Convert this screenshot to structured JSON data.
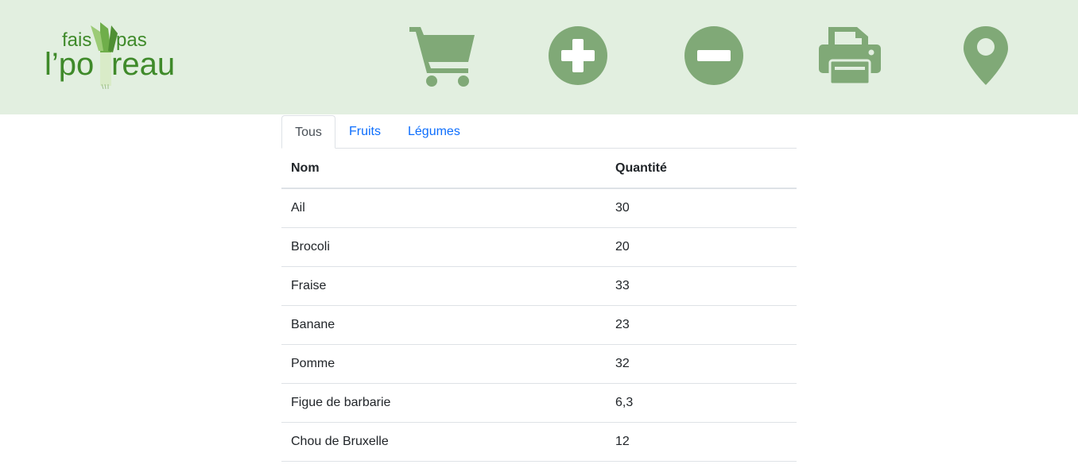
{
  "header": {
    "logo": {
      "line1_a": "fais",
      "line1_b": "pas",
      "line2_a": "l’po",
      "line2_b": "reau"
    },
    "icons": [
      {
        "name": "cart-icon"
      },
      {
        "name": "add-circle-icon"
      },
      {
        "name": "remove-circle-icon"
      },
      {
        "name": "print-icon"
      },
      {
        "name": "map-marker-icon"
      }
    ],
    "icon_color": "#80a977",
    "background_color": "#e2efe0"
  },
  "tabs": [
    {
      "label": "Tous",
      "active": true
    },
    {
      "label": "Fruits",
      "active": false
    },
    {
      "label": "Légumes",
      "active": false
    }
  ],
  "table": {
    "columns": [
      "Nom",
      "Quantité"
    ],
    "rows": [
      [
        "Ail",
        "30"
      ],
      [
        "Brocoli",
        "20"
      ],
      [
        "Fraise",
        "33"
      ],
      [
        "Banane",
        "23"
      ],
      [
        "Pomme",
        "32"
      ],
      [
        "Figue de barbarie",
        "6,3"
      ],
      [
        "Chou de Bruxelle",
        "12"
      ]
    ]
  },
  "colors": {
    "link": "#0d6efd",
    "text": "#212529",
    "border": "#dee2e6"
  }
}
